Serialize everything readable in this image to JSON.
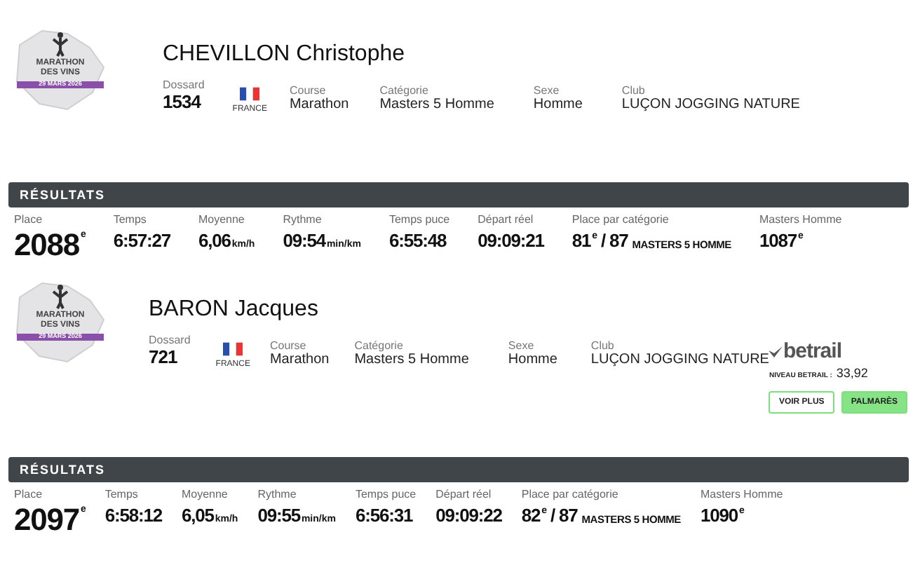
{
  "athletes": [
    {
      "logo": {
        "line1": "MARATHON",
        "line2": "DES VINS",
        "date": "29 MARS 2026"
      },
      "name": "CHEVILLON Christophe",
      "bib_label": "Dossard",
      "bib": "1534",
      "country": "FRANCE",
      "fields": [
        {
          "label": "Course",
          "value": "Marathon"
        },
        {
          "label": "Catégorie",
          "value": "Masters 5 Homme"
        },
        {
          "label": "Sexe",
          "value": "Homme"
        },
        {
          "label": "Club",
          "value": "LUÇON JOGGING NATURE"
        }
      ],
      "results_title": "RÉSULTATS",
      "results": [
        {
          "kind": "place",
          "label": "Place",
          "value": "2088",
          "sup": "e"
        },
        {
          "kind": "stat",
          "label": "Temps",
          "value": "6:57:27"
        },
        {
          "kind": "stat",
          "label": "Moyenne",
          "value": "6,06",
          "unit": "km/h"
        },
        {
          "kind": "stat",
          "label": "Rythme",
          "value": "09:54",
          "unit": "min/km"
        },
        {
          "kind": "stat",
          "label": "Temps puce",
          "value": "6:55:48"
        },
        {
          "kind": "stat",
          "label": "Départ réel",
          "value": "09:09:21"
        },
        {
          "kind": "stat",
          "label": "Place par catégorie",
          "value": "81",
          "sup": "e",
          "rest": "/ 87",
          "tag": "MASTERS 5 HOMME"
        },
        {
          "kind": "stat",
          "label": "Masters Homme",
          "value": "1087",
          "sup": "e"
        }
      ]
    },
    {
      "logo": {
        "line1": "MARATHON",
        "line2": "DES VINS",
        "date": "29 MARS 2026"
      },
      "name": "BARON Jacques",
      "bib_label": "Dossard",
      "bib": "721",
      "country": "FRANCE",
      "fields": [
        {
          "label": "Course",
          "value": "Marathon"
        },
        {
          "label": "Catégorie",
          "value": "Masters 5 Homme"
        },
        {
          "label": "Sexe",
          "value": "Homme"
        },
        {
          "label": "Club",
          "value": "LUÇON JOGGING NATURE"
        }
      ],
      "betrail": {
        "brand": "betrail",
        "level_label": "NIVEAU BETRAIL :",
        "level_value": "33,92",
        "buttons": [
          {
            "kind": "outline",
            "label": "VOIR PLUS"
          },
          {
            "kind": "filled",
            "label": "PALMARÈS"
          }
        ]
      },
      "results_title": "RÉSULTATS",
      "results": [
        {
          "kind": "place",
          "label": "Place",
          "value": "2097",
          "sup": "e"
        },
        {
          "kind": "stat",
          "label": "Temps",
          "value": "6:58:12"
        },
        {
          "kind": "stat",
          "label": "Moyenne",
          "value": "6,05",
          "unit": "km/h"
        },
        {
          "kind": "stat",
          "label": "Rythme",
          "value": "09:55",
          "unit": "min/km"
        },
        {
          "kind": "stat",
          "label": "Temps puce",
          "value": "6:56:31"
        },
        {
          "kind": "stat",
          "label": "Départ réel",
          "value": "09:09:22"
        },
        {
          "kind": "stat",
          "label": "Place par catégorie",
          "value": "82",
          "sup": "e",
          "rest": "/ 87",
          "tag": "MASTERS 5 HOMME"
        },
        {
          "kind": "stat",
          "label": "Masters Homme",
          "value": "1090",
          "sup": "e"
        }
      ]
    }
  ]
}
